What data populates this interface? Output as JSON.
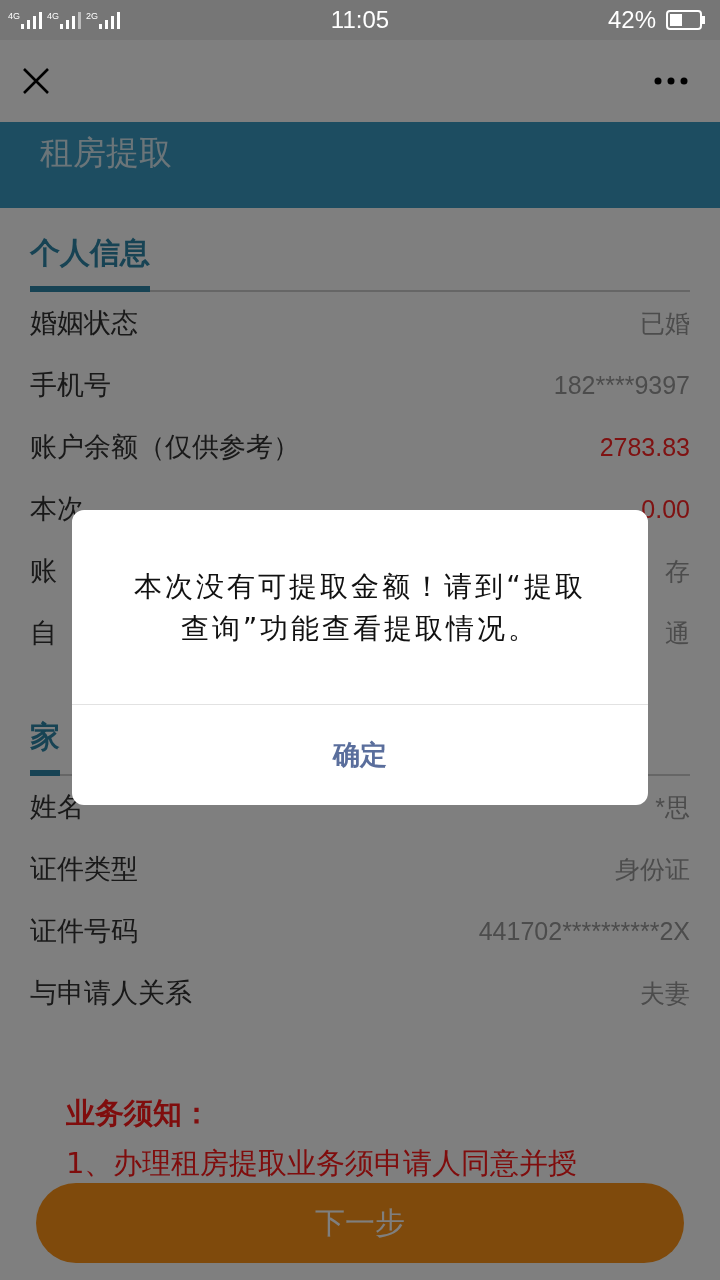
{
  "status_bar": {
    "networks": [
      "4G",
      "4G",
      "2G"
    ],
    "time": "11:05",
    "battery": "42%"
  },
  "title": "租房提取",
  "sections": [
    {
      "heading": "个人信息",
      "rows": [
        {
          "label": "婚姻状态",
          "value": "已婚",
          "highlight": false
        },
        {
          "label": "手机号",
          "value": "182****9397",
          "highlight": false
        },
        {
          "label": "账户余额（仅供参考）",
          "value": "2783.83",
          "highlight": true
        },
        {
          "label": "本次",
          "value": "0.00",
          "highlight": true
        },
        {
          "label": "账",
          "value": "存",
          "highlight": false
        },
        {
          "label": "自",
          "value": "通",
          "highlight": false
        }
      ]
    },
    {
      "heading": "家",
      "rows": [
        {
          "label": "姓名",
          "value": "*思",
          "highlight": false
        },
        {
          "label": "证件类型",
          "value": "身份证",
          "highlight": false
        },
        {
          "label": "证件号码",
          "value": "441702**********2X",
          "highlight": false
        },
        {
          "label": "与申请人关系",
          "value": "夫妻",
          "highlight": false
        }
      ]
    }
  ],
  "notice": {
    "heading": "业务须知：",
    "lines": [
      "1、办理租房提取业务须申请人同意并授"
    ]
  },
  "next_button": "下一步",
  "dialog": {
    "message": "本次没有可提取金额！请到“提取查询”功能查看提取情况。",
    "confirm": "确定"
  }
}
